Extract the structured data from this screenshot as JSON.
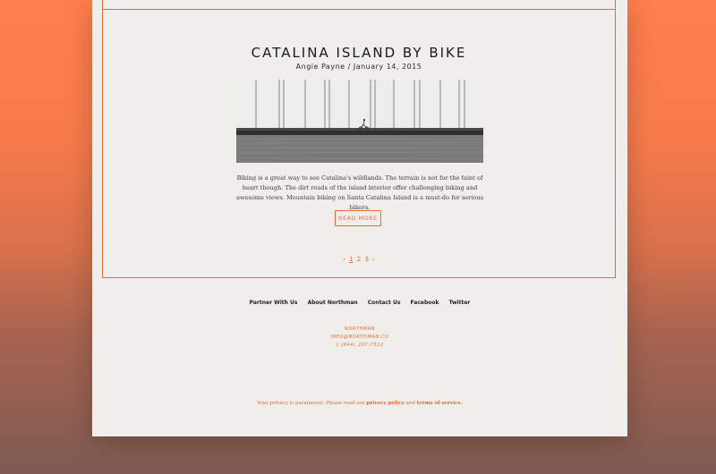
{
  "post": {
    "title": "CATALINA ISLAND BY BIKE",
    "meta": "Angie Payne / January 14, 2015",
    "excerpt": "Biking is a great way to see Catalina's wildlands. The terrain is not for the faint of heart though. The dirt roads of the island interior offer challenging biking and awesome views. Mountain biking on Santa Catalina Island is a must-do for serious bikers.",
    "read_more_label": "READ MORE"
  },
  "pagination": {
    "prev_icon": "chevron-left-icon",
    "next_icon": "chevron-right-icon",
    "pages": [
      "1",
      "2",
      "3"
    ],
    "current": "1"
  },
  "footer": {
    "nav": [
      "Partner With Us",
      "About Northman",
      "Contact Us",
      "Facebook",
      "Twitter"
    ],
    "contact": {
      "name": "NORTHMAN",
      "email": "INFO@NORTHMAN.CO",
      "phone": "1 (844) 207-7522"
    },
    "privacy": {
      "prefix": "Your privacy is paramount. Please read our",
      "policy_link": "privacy policy",
      "and": "and",
      "terms_link": "terms of service."
    }
  },
  "colors": {
    "accent": "#e56a33",
    "page_background": "#efeeea",
    "backdrop_top": "#ff7e4c"
  }
}
